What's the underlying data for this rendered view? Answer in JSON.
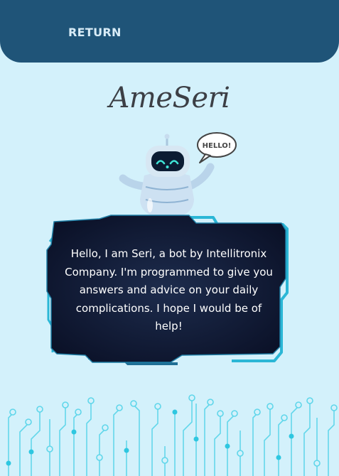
{
  "header": {
    "return_label": "RETURN"
  },
  "app": {
    "logo_text": "AmeSeri"
  },
  "robot": {
    "speech_bubble": "HELLO!"
  },
  "message": {
    "text": "Hello, I am Seri, a bot by Intellitronix Company. I'm programmed to give you answers and advice on your daily complications. I hope I would be of help!"
  },
  "colors": {
    "background": "#d3f1fb",
    "header": "#1f5478",
    "panel": "#0e1530",
    "accent": "#2bb7d6"
  }
}
